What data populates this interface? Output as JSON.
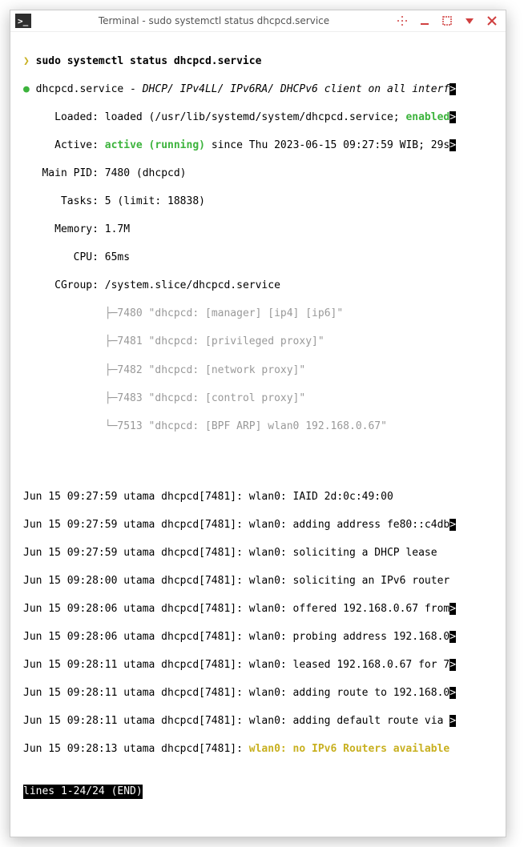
{
  "window": {
    "title": "Terminal - sudo systemctl status dhcpcd.service",
    "icon_glyph": ">_"
  },
  "prompt": {
    "caret": "❯",
    "command": "sudo systemctl status dhcpcd.service"
  },
  "status": {
    "bullet": "●",
    "unit": "dhcpcd.service",
    "desc": "DHCP/ IPv4LL/ IPv6RA/ DHCPv6 client on all interf",
    "loaded_label": "Loaded:",
    "loaded_value": "loaded (/usr/lib/systemd/system/dhcpcd.service; ",
    "loaded_enabled": "enabled",
    "active_label": "Active:",
    "active_state": "active (running)",
    "active_since": " since Thu 2023-06-15 09:27:59 WIB; 29s",
    "mainpid_label": "Main PID:",
    "mainpid_value": "7480 (dhcpcd)",
    "tasks_label": "Tasks:",
    "tasks_value": "5 (limit: 18838)",
    "memory_label": "Memory:",
    "memory_value": "1.7M",
    "cpu_label": "CPU:",
    "cpu_value": "65ms",
    "cgroup_label": "CGroup:",
    "cgroup_value": "/system.slice/dhcpcd.service"
  },
  "tree": [
    {
      "branch": "├─",
      "pid": "7480",
      "text": "\"dhcpcd: [manager] [ip4] [ip6]\""
    },
    {
      "branch": "├─",
      "pid": "7481",
      "text": "\"dhcpcd: [privileged proxy]\""
    },
    {
      "branch": "├─",
      "pid": "7482",
      "text": "\"dhcpcd: [network proxy]\""
    },
    {
      "branch": "├─",
      "pid": "7483",
      "text": "\"dhcpcd: [control proxy]\""
    },
    {
      "branch": "└─",
      "pid": "7513",
      "text": "\"dhcpcd: [BPF ARP] wlan0 192.168.0.67\""
    }
  ],
  "log": [
    {
      "prefix": "Jun 15 09:27:59 utama dhcpcd[7481]: ",
      "msg": "wlan0: IAID 2d:0c:49:00",
      "trunc": false
    },
    {
      "prefix": "Jun 15 09:27:59 utama dhcpcd[7481]: ",
      "msg": "wlan0: adding address fe80::c4db",
      "trunc": true
    },
    {
      "prefix": "Jun 15 09:27:59 utama dhcpcd[7481]: ",
      "msg": "wlan0: soliciting a DHCP lease",
      "trunc": false
    },
    {
      "prefix": "Jun 15 09:28:00 utama dhcpcd[7481]: ",
      "msg": "wlan0: soliciting an IPv6 router",
      "trunc": false
    },
    {
      "prefix": "Jun 15 09:28:06 utama dhcpcd[7481]: ",
      "msg": "wlan0: offered 192.168.0.67 from",
      "trunc": true
    },
    {
      "prefix": "Jun 15 09:28:06 utama dhcpcd[7481]: ",
      "msg": "wlan0: probing address 192.168.0",
      "trunc": true
    },
    {
      "prefix": "Jun 15 09:28:11 utama dhcpcd[7481]: ",
      "msg": "wlan0: leased 192.168.0.67 for 7",
      "trunc": true
    },
    {
      "prefix": "Jun 15 09:28:11 utama dhcpcd[7481]: ",
      "msg": "wlan0: adding route to 192.168.0",
      "trunc": true
    },
    {
      "prefix": "Jun 15 09:28:11 utama dhcpcd[7481]: ",
      "msg": "wlan0: adding default route via ",
      "trunc": true
    },
    {
      "prefix": "Jun 15 09:28:13 utama dhcpcd[7481]: ",
      "msg_yellow": "wlan0: no IPv6 Routers available",
      "trunc": false
    }
  ],
  "pager": "lines 1-24/24 (END)"
}
